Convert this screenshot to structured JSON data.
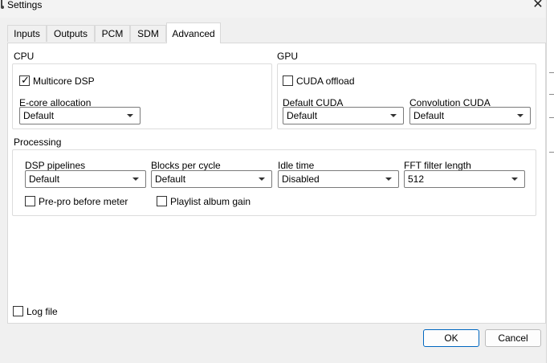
{
  "window": {
    "title": "Settings",
    "close_glyph": "✕",
    "icon": "app-icon"
  },
  "tabs": [
    {
      "label": "Inputs",
      "active": false
    },
    {
      "label": "Outputs",
      "active": false
    },
    {
      "label": "PCM",
      "active": false
    },
    {
      "label": "SDM",
      "active": false
    },
    {
      "label": "Advanced",
      "active": true
    }
  ],
  "cpu": {
    "title": "CPU",
    "multicore": {
      "label": "Multicore DSP",
      "checked": true
    },
    "ecore": {
      "label": "E-core allocation",
      "value": "Default"
    }
  },
  "gpu": {
    "title": "GPU",
    "cuda_offload": {
      "label": "CUDA offload",
      "checked": false
    },
    "default_cuda": {
      "label": "Default CUDA",
      "value": "Default"
    },
    "convolution_cuda": {
      "label": "Convolution CUDA",
      "value": "Default"
    }
  },
  "processing": {
    "title": "Processing",
    "dsp_pipelines": {
      "label": "DSP pipelines",
      "value": "Default"
    },
    "blocks_per_cycle": {
      "label": "Blocks per cycle",
      "value": "Default"
    },
    "idle_time": {
      "label": "Idle time",
      "value": "Disabled"
    },
    "fft_filter_length": {
      "label": "FFT filter length",
      "value": "512"
    },
    "prepro": {
      "label": "Pre-pro before meter",
      "checked": false
    },
    "playlist_gain": {
      "label": "Playlist album gain",
      "checked": false
    }
  },
  "log_file": {
    "label": "Log file",
    "checked": false
  },
  "buttons": {
    "ok": "OK",
    "cancel": "Cancel"
  },
  "colors": {
    "accent": "#0067c0",
    "panel": "#ffffff",
    "window": "#f0f0f0"
  }
}
